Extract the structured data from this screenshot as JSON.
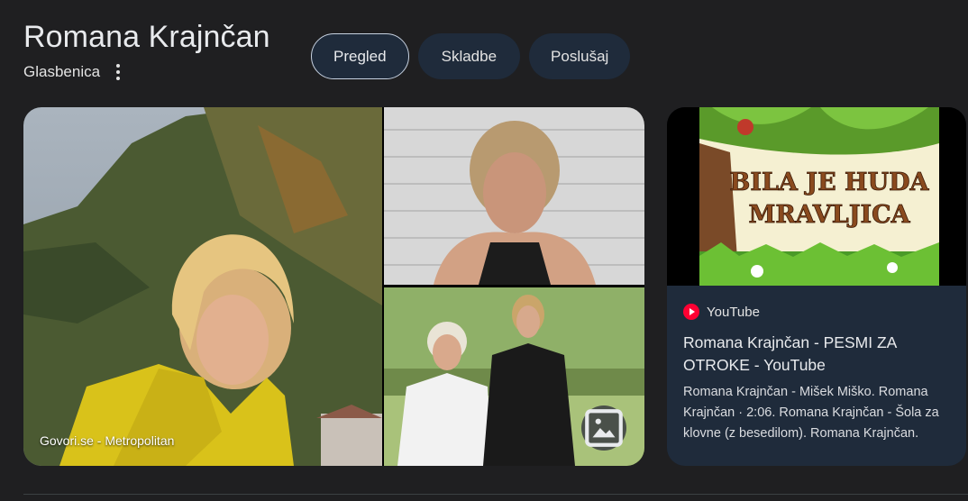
{
  "header": {
    "title": "Romana Krajnčan",
    "subtitle": "Glasbenica"
  },
  "tabs": [
    {
      "label": "Pregled",
      "active": true
    },
    {
      "label": "Skladbe",
      "active": false
    },
    {
      "label": "Poslušaj",
      "active": false
    }
  ],
  "gallery": {
    "caption": "Govori.se - Metropolitan",
    "photo_button_icon": "image-icon"
  },
  "video": {
    "thumbnail_text_line1": "BILA JE HUDA",
    "thumbnail_text_line2": "MRAVLJICA",
    "source": "YouTube",
    "title": "Romana Krajnčan - PESMI ZA OTROKE - YouTube",
    "snippet": "Romana Krajnčan - Mišek Miško. Romana Krajnčan · 2:06. Romana Krajnčan - Šola za klovne (z besedilom). Romana Krajnčan."
  },
  "colors": {
    "background": "#1f1f21",
    "chip": "#1f2b3b",
    "youtube_red": "#ff0033"
  }
}
